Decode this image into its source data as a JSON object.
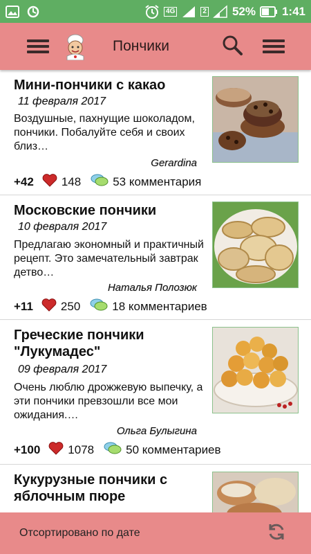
{
  "status_bar": {
    "signal": "4G",
    "sim": "2",
    "battery": "52%",
    "time": "1:41",
    "colors": {
      "background": "#5fae62"
    }
  },
  "toolbar": {
    "title": "Пончики",
    "background": "#e88a8a"
  },
  "recipes": [
    {
      "title": "Мини-пончики с какао",
      "date": "11 февраля 2017",
      "description": "Воздушные, пахнущие шоколадом, пончики. Побалуйте себя и своих близ…",
      "author": "Gerardina",
      "votes": "+42",
      "likes": "148",
      "comments": "53 комментария"
    },
    {
      "title": "Московские пончики",
      "date": "10 февраля 2017",
      "description": "Предлагаю экономный и практичный рецепт. Это замечательный завтрак детво…",
      "author": "Наталья Полозюк",
      "votes": "+11",
      "likes": "250",
      "comments": "18 комментариев"
    },
    {
      "title": "Греческие пончики \"Лукумадес\"",
      "date": "09 февраля 2017",
      "description": "Очень люблю дрожжевую выпечку, а эти пончики превзошли все мои ожидания.…",
      "author": "Ольга Булыгина",
      "votes": "+100",
      "likes": "1078",
      "comments": "50 комментариев"
    },
    {
      "title": "Кукурузные пончики с яблочным пюре"
    }
  ],
  "bottom_bar": {
    "sort_label": "Отсортировано по дате"
  }
}
